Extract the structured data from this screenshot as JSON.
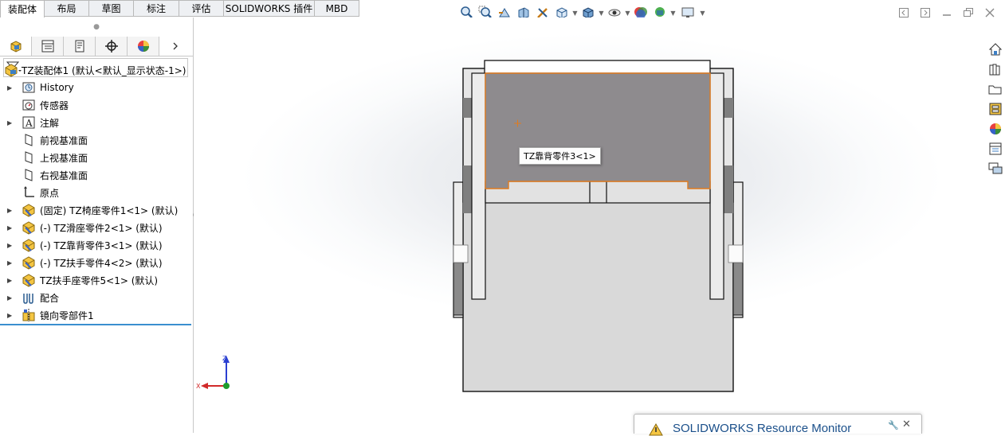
{
  "tabs": [
    {
      "label": "装配体",
      "active": true
    },
    {
      "label": "布局"
    },
    {
      "label": "草图"
    },
    {
      "label": "标注"
    },
    {
      "label": "评估"
    },
    {
      "label": "SOLIDWORKS 插件"
    },
    {
      "label": "MBD"
    }
  ],
  "tree": {
    "root": "TZ装配体1 (默认<默认_显示状态-1>)",
    "items": [
      {
        "label": "History",
        "icon": "history-icon",
        "expandable": true
      },
      {
        "label": "传感器",
        "icon": "sensor-icon",
        "expandable": false
      },
      {
        "label": "注解",
        "icon": "annotation-icon",
        "expandable": true
      },
      {
        "label": "前视基准面",
        "icon": "plane-icon",
        "expandable": false
      },
      {
        "label": "上视基准面",
        "icon": "plane-icon",
        "expandable": false
      },
      {
        "label": "右视基准面",
        "icon": "plane-icon",
        "expandable": false
      },
      {
        "label": "原点",
        "icon": "origin-icon",
        "expandable": false
      },
      {
        "label": "(固定) TZ椅座零件1<1> (默认)",
        "icon": "part-icon",
        "expandable": true
      },
      {
        "label": "(-) TZ滑座零件2<1> (默认)",
        "icon": "part-icon",
        "expandable": true
      },
      {
        "label": "(-) TZ靠背零件3<1> (默认)",
        "icon": "part-icon",
        "expandable": true
      },
      {
        "label": "(-) TZ扶手零件4<2> (默认)",
        "icon": "part-icon",
        "expandable": true
      },
      {
        "label": "TZ扶手座零件5<1> (默认)",
        "icon": "part-icon",
        "expandable": true
      },
      {
        "label": "配合",
        "icon": "mates-icon",
        "expandable": true
      },
      {
        "label": "镜向零部件1",
        "icon": "mirror-component-icon",
        "expandable": true
      }
    ]
  },
  "viewport": {
    "tooltip": "TZ靠背零件3<1>",
    "triad": {
      "z": "Z",
      "x": "X"
    }
  },
  "resource_monitor": {
    "title": "SOLIDWORKS Resource Monitor"
  },
  "colors": {
    "highlight": "#e07b1e",
    "selected_face": "#8e8b8e",
    "body_face": "#d9d9d9",
    "tree_accent": "#3a8fcf"
  }
}
